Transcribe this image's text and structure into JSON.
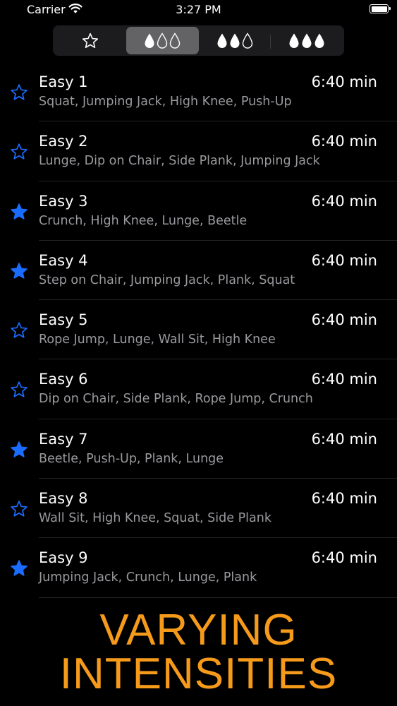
{
  "status_bar": {
    "carrier": "Carrier",
    "time": "3:27 PM"
  },
  "filter": {
    "segments": [
      {
        "name": "favorites",
        "icon": "star-outline-icon",
        "selected": false
      },
      {
        "name": "easy",
        "icon": "droplet-1-of-3-icon",
        "selected": true
      },
      {
        "name": "medium",
        "icon": "droplet-2-of-3-icon",
        "selected": false
      },
      {
        "name": "hard",
        "icon": "droplet-3-of-3-icon",
        "selected": false
      }
    ]
  },
  "workouts": [
    {
      "title": "Easy 1",
      "duration": "6:40 min",
      "exercises": "Squat, Jumping Jack, High Knee, Push-Up",
      "favorite": false
    },
    {
      "title": "Easy 2",
      "duration": "6:40 min",
      "exercises": "Lunge, Dip on Chair, Side Plank, Jumping Jack",
      "favorite": false
    },
    {
      "title": "Easy 3",
      "duration": "6:40 min",
      "exercises": "Crunch, High Knee, Lunge, Beetle",
      "favorite": true
    },
    {
      "title": "Easy 4",
      "duration": "6:40 min",
      "exercises": "Step on Chair, Jumping Jack, Plank, Squat",
      "favorite": true
    },
    {
      "title": "Easy 5",
      "duration": "6:40 min",
      "exercises": "Rope Jump, Lunge, Wall Sit, High Knee",
      "favorite": false
    },
    {
      "title": "Easy 6",
      "duration": "6:40 min",
      "exercises": "Dip on Chair, Side Plank, Rope Jump, Crunch",
      "favorite": false
    },
    {
      "title": "Easy 7",
      "duration": "6:40 min",
      "exercises": "Beetle, Push-Up, Plank, Lunge",
      "favorite": true
    },
    {
      "title": "Easy 8",
      "duration": "6:40 min",
      "exercises": "Wall Sit, High Knee, Squat, Side Plank",
      "favorite": false
    },
    {
      "title": "Easy 9",
      "duration": "6:40 min",
      "exercises": "Jumping Jack, Crunch, Lunge, Plank",
      "favorite": true
    }
  ],
  "tagline": {
    "line1": "VARYING",
    "line2": "INTENSITIES"
  },
  "colors": {
    "background": "#000000",
    "accent_star": "#1a6cff",
    "tagline": "#f59a1a",
    "subtitle": "#9a9a9f"
  }
}
